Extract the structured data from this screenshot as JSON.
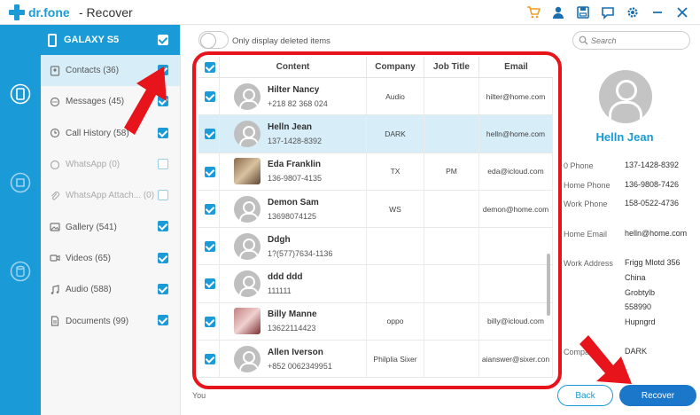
{
  "app": {
    "brand": "dr.fone",
    "title": "- Recover"
  },
  "toolbar_icons": [
    "cart-icon",
    "user-icon",
    "save-icon",
    "feedback-icon",
    "settings-icon",
    "minimize-icon",
    "close-icon"
  ],
  "sidebar": {
    "device": "GALAXY S5",
    "items": [
      {
        "label": "Contacts (36)",
        "icon": "contacts-icon",
        "checked": true,
        "active": true
      },
      {
        "label": "Messages (45)",
        "icon": "messages-icon",
        "checked": true
      },
      {
        "label": "Call History (58)",
        "icon": "call-history-icon",
        "checked": true
      },
      {
        "label": "WhatsApp (0)",
        "icon": "whatsapp-icon",
        "checked": false,
        "disabled": true
      },
      {
        "label": "WhatsApp Attach... (0)",
        "icon": "attachment-icon",
        "checked": false,
        "disabled": true
      },
      {
        "label": "Gallery (541)",
        "icon": "gallery-icon",
        "checked": true
      },
      {
        "label": "Videos (65)",
        "icon": "videos-icon",
        "checked": true
      },
      {
        "label": "Audio (588)",
        "icon": "audio-icon",
        "checked": true
      },
      {
        "label": "Documents (99)",
        "icon": "documents-icon",
        "checked": true
      }
    ]
  },
  "filter": {
    "toggle_label": "Only display deleted items",
    "search_placeholder": "Search"
  },
  "table": {
    "headers": {
      "content": "Content",
      "company": "Company",
      "job_title": "Job Title",
      "email": "Email"
    },
    "rows": [
      {
        "name": "Hilter Nancy",
        "phone": "+218 82 368 024",
        "company": "Audio",
        "job": "",
        "email": "hilter@home.com",
        "avatar": "default"
      },
      {
        "name": "Helln Jean",
        "phone": "137-1428-8392",
        "company": "DARK",
        "job": "",
        "email": "helln@home.com",
        "avatar": "default",
        "selected": true
      },
      {
        "name": "Eda Franklin",
        "phone": "136-9807-4135",
        "company": "TX",
        "job": "PM",
        "email": "eda@icloud.com",
        "avatar": "photo1"
      },
      {
        "name": "Demon Sam",
        "phone": "13698074125",
        "company": "WS",
        "job": "",
        "email": "demon@home.com",
        "avatar": "default"
      },
      {
        "name": "Ddgh",
        "phone": "1?(577)7634-1136",
        "company": "",
        "job": "",
        "email": "",
        "avatar": "default"
      },
      {
        "name": "ddd ddd",
        "phone": "111111",
        "company": "",
        "job": "",
        "email": "",
        "avatar": "default"
      },
      {
        "name": "Billy Manne",
        "phone": "13622114423",
        "company": "oppo",
        "job": "",
        "email": "billy@icloud.com",
        "avatar": "photo2"
      },
      {
        "name": "Allen Iverson",
        "phone": "+852 0062349951",
        "company": "Philplia Sixer",
        "job": "",
        "email": "aianswer@sixer.con",
        "avatar": "default"
      }
    ]
  },
  "detail": {
    "name": "Helln Jean",
    "fields": [
      {
        "label": "0 Phone",
        "value": "137-1428-8392"
      },
      {
        "label": "Home Phone",
        "value": "136-9808-7426"
      },
      {
        "label": "Work Phone",
        "value": "158-0522-4736"
      },
      {
        "label": "Home Email",
        "value": "helln@home.com"
      },
      {
        "label": "Work Address",
        "value_lines": [
          "Frigg Mlotd 356",
          "China",
          "Grobtylb",
          "558990",
          "Hupngrd"
        ]
      },
      {
        "label": "Company",
        "value": "DARK"
      }
    ]
  },
  "footer": {
    "text": "You",
    "back_label": "Back",
    "recover_label": "Recover"
  },
  "colors": {
    "accent": "#1a9bd7",
    "highlight": "#e8141c",
    "recover_button": "#1a77c9"
  }
}
